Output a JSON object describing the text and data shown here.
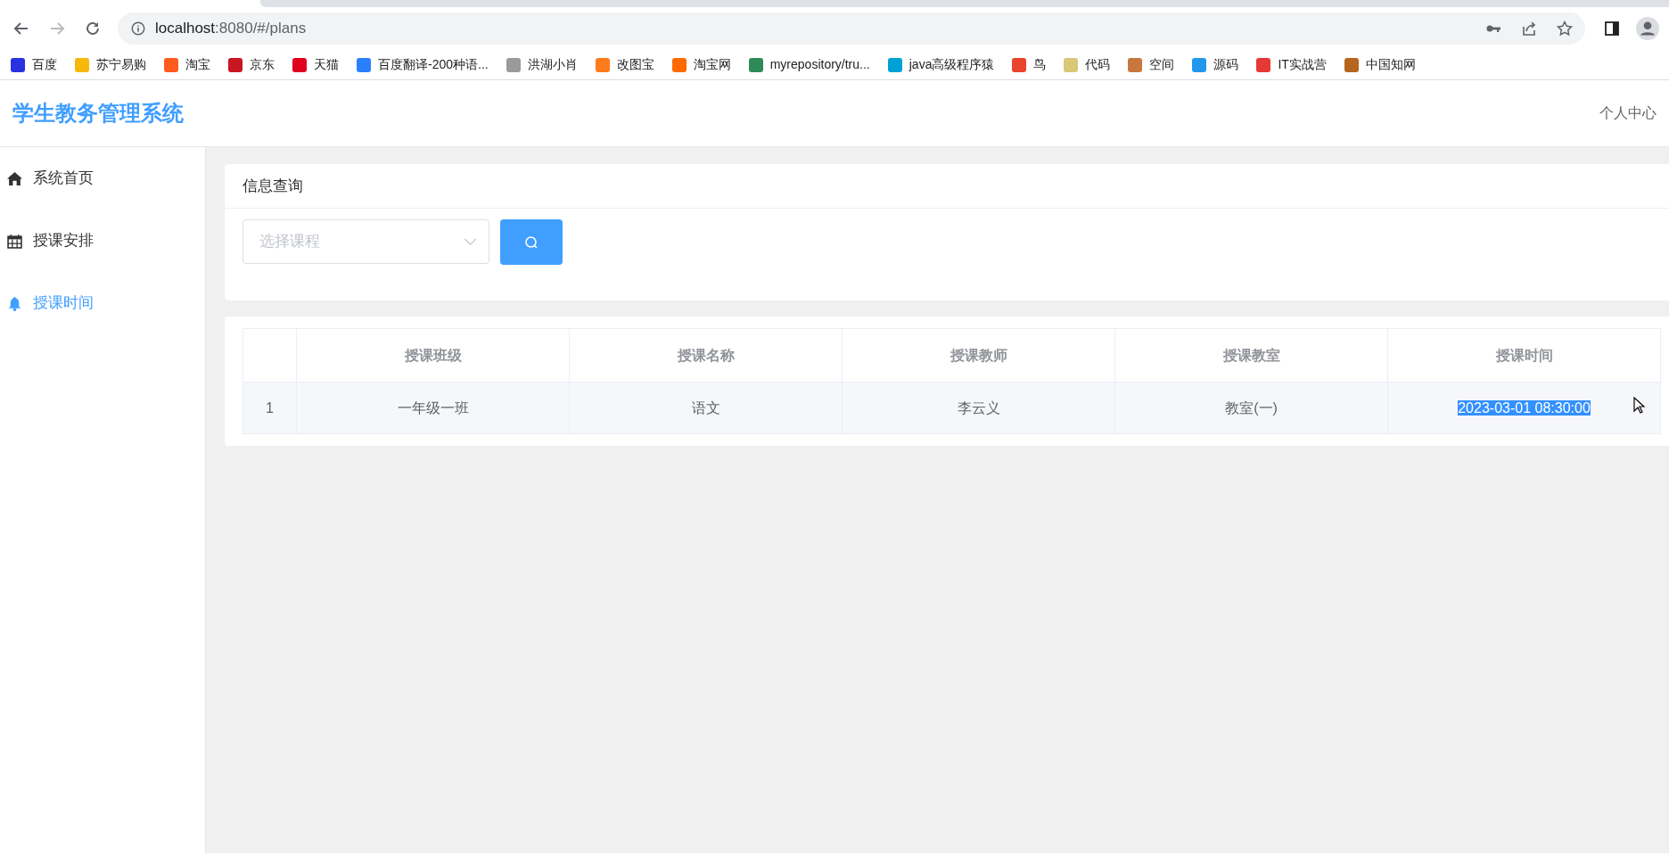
{
  "browser": {
    "url_host": "localhost",
    "url_rest": ":8080/#/plans",
    "back_disabled": false,
    "forward_disabled": true
  },
  "bookmarks": [
    {
      "label": "百度",
      "color": "#2932e1"
    },
    {
      "label": "苏宁易购",
      "color": "#f5b80b"
    },
    {
      "label": "淘宝",
      "color": "#ff5a1f"
    },
    {
      "label": "京东",
      "color": "#c81623"
    },
    {
      "label": "天猫",
      "color": "#e1001e"
    },
    {
      "label": "百度翻译-200种语...",
      "color": "#2a7fff"
    },
    {
      "label": "洪湖小肖",
      "color": "#9a9a9a"
    },
    {
      "label": "改图宝",
      "color": "#ff7a1a"
    },
    {
      "label": "淘宝网",
      "color": "#ff6a00"
    },
    {
      "label": "myrepository/tru...",
      "color": "#2e8b57"
    },
    {
      "label": "java高级程序猿",
      "color": "#00a1d6"
    },
    {
      "label": "鸟",
      "color": "#e8452c"
    },
    {
      "label": "代码",
      "color": "#d8c878"
    },
    {
      "label": "空间",
      "color": "#c8783c"
    },
    {
      "label": "源码",
      "color": "#2396ed"
    },
    {
      "label": "IT实战营",
      "color": "#e53935"
    },
    {
      "label": "中国知网",
      "color": "#b5651d"
    }
  ],
  "app": {
    "title": "学生教务管理系统",
    "user_menu": "个人中心"
  },
  "sidebar": {
    "items": [
      {
        "label": "系统首页",
        "selected": false
      },
      {
        "label": "授课安排",
        "selected": false
      },
      {
        "label": "授课时间",
        "selected": true
      }
    ]
  },
  "query_card": {
    "title": "信息查询",
    "course_select": {
      "placeholder": "选择课程"
    }
  },
  "table": {
    "columns": [
      "",
      "授课班级",
      "授课名称",
      "授课教师",
      "授课教室",
      "授课时间"
    ],
    "rows": [
      {
        "cells": [
          {
            "text": "1",
            "text_selected": false
          },
          {
            "text": "一年级一班",
            "text_selected": false
          },
          {
            "text": "语文",
            "text_selected": false
          },
          {
            "text": "李云义",
            "text_selected": false
          },
          {
            "text": "教室(一)",
            "text_selected": false
          },
          {
            "text": "2023-03-01 08:30:00",
            "text_selected": true
          }
        ]
      }
    ]
  }
}
